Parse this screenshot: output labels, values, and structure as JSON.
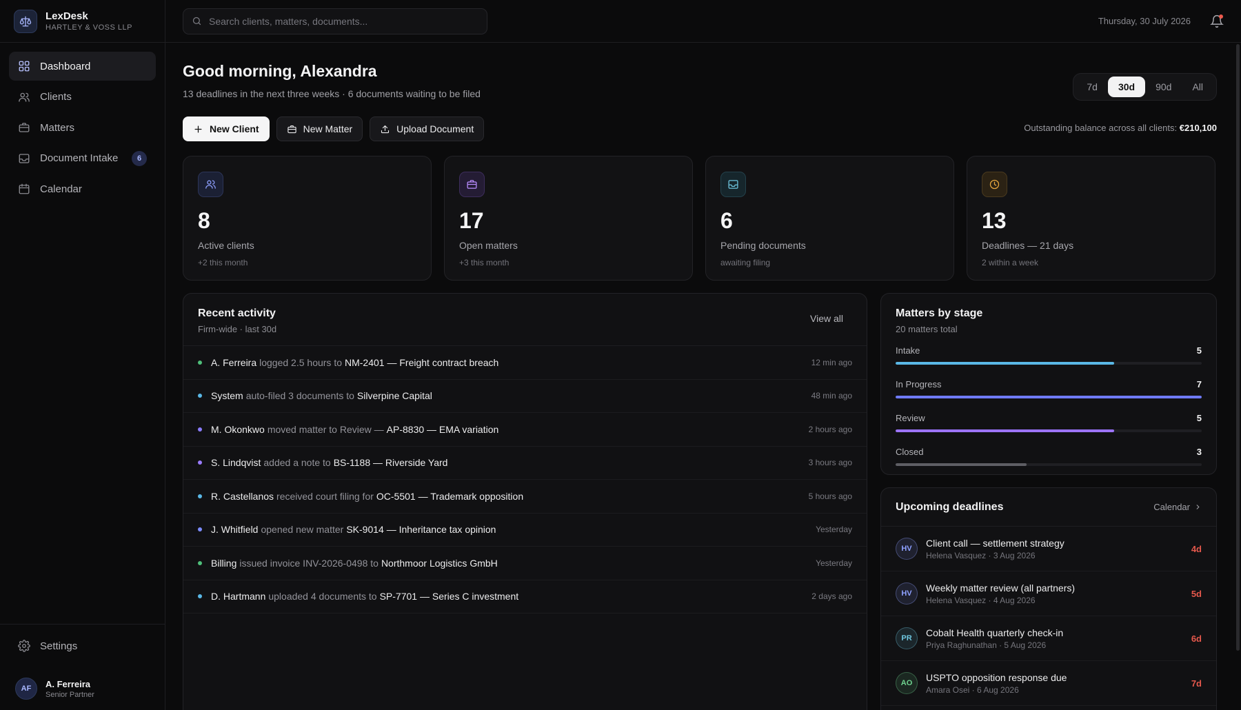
{
  "brand": {
    "name": "LexDesk",
    "firm": "HARTLEY & VOSS LLP",
    "logo_icon": "scales-icon"
  },
  "nav": {
    "items": [
      {
        "label": "Dashboard",
        "icon": "grid-icon",
        "active": true
      },
      {
        "label": "Clients",
        "icon": "users-icon"
      },
      {
        "label": "Matters",
        "icon": "briefcase-icon"
      },
      {
        "label": "Document Intake",
        "icon": "inbox-icon",
        "badge": "6"
      },
      {
        "label": "Calendar",
        "icon": "calendar-icon"
      }
    ],
    "settings_label": "Settings"
  },
  "user": {
    "initials": "AF",
    "name": "A. Ferreira",
    "role": "Senior Partner"
  },
  "topbar": {
    "search_placeholder": "Search clients, matters, documents...",
    "date": "Thursday, 30 July 2026"
  },
  "header": {
    "greeting": "Good morning, Alexandra",
    "subline": "13 deadlines in the next three weeks · 6 documents waiting to be filed",
    "ranges": [
      "7d",
      "30d",
      "90d",
      "All"
    ],
    "active_range": "30d",
    "balance_label": "Outstanding balance across all clients:",
    "balance_value": "€210,100"
  },
  "actions": {
    "new_client": "New Client",
    "new_matter": "New Matter",
    "upload": "Upload Document"
  },
  "stats": [
    {
      "value": "8",
      "label": "Active clients",
      "sub": "+2 this month",
      "icon": "users-icon",
      "color": "#8ea0ff"
    },
    {
      "value": "17",
      "label": "Open matters",
      "sub": "+3 this month",
      "icon": "briefcase-icon",
      "color": "#b98cff"
    },
    {
      "value": "6",
      "label": "Pending documents",
      "sub": "awaiting filing",
      "icon": "inbox-icon",
      "color": "#6fc7e0"
    },
    {
      "value": "13",
      "label": "Deadlines — 21 days",
      "sub": "2 within a week",
      "icon": "clock-icon",
      "color": "#e8a73e"
    }
  ],
  "activity": {
    "title": "Recent activity",
    "subtitle": "Firm-wide · last 30d",
    "view_all": "View all",
    "rows": [
      {
        "actor": "A. Ferreira",
        "verb": "logged 2.5 hours to",
        "target": "NM-2401 — Freight contract breach",
        "time": "12 min ago",
        "color": "#4fbf7a"
      },
      {
        "actor": "System",
        "verb": "auto-filed 3 documents to",
        "target": "Silverpine Capital",
        "time": "48 min ago",
        "color": "#5ab8e6"
      },
      {
        "actor": "M. Okonkwo",
        "verb": "moved matter to Review —",
        "target": "AP-8830 — EMA variation",
        "time": "2 hours ago",
        "color": "#8a7cff"
      },
      {
        "actor": "S. Lindqvist",
        "verb": "added a note to",
        "target": "BS-1188 — Riverside Yard",
        "time": "3 hours ago",
        "color": "#9a7cff"
      },
      {
        "actor": "R. Castellanos",
        "verb": "received court filing for",
        "target": "OC-5501 — Trademark opposition",
        "time": "5 hours ago",
        "color": "#5ab8e6"
      },
      {
        "actor": "J. Whitfield",
        "verb": "opened new matter",
        "target": "SK-9014 — Inheritance tax opinion",
        "time": "Yesterday",
        "color": "#7c8cff"
      },
      {
        "actor": "Billing",
        "verb": "issued invoice INV-2026-0498 to",
        "target": "Northmoor Logistics GmbH",
        "time": "Yesterday",
        "color": "#4fbf7a"
      },
      {
        "actor": "D. Hartmann",
        "verb": "uploaded 4 documents to",
        "target": "SP-7701 — Series C investment",
        "time": "2 days ago",
        "color": "#5ab8e6"
      }
    ]
  },
  "stages": {
    "title": "Matters by stage",
    "subtitle": "20 matters total",
    "max": 7,
    "rows": [
      {
        "label": "Intake",
        "count": "5",
        "value": 5,
        "color": "#5ab8e6"
      },
      {
        "label": "In Progress",
        "count": "7",
        "value": 7,
        "color": "#6f7bff"
      },
      {
        "label": "Review",
        "count": "5",
        "value": 5,
        "color": "#9c74ff"
      },
      {
        "label": "Closed",
        "count": "3",
        "value": 3,
        "color": "#5e5e64"
      }
    ]
  },
  "deadlines": {
    "title": "Upcoming deadlines",
    "link": "Calendar",
    "rows": [
      {
        "initials": "HV",
        "title": "Client call — settlement strategy",
        "meta": "Helena Vasquez · 3 Aug 2026",
        "days": "4d",
        "color": "#8ea0ff"
      },
      {
        "initials": "HV",
        "title": "Weekly matter review (all partners)",
        "meta": "Helena Vasquez · 4 Aug 2026",
        "days": "5d",
        "color": "#8ea0ff"
      },
      {
        "initials": "PR",
        "title": "Cobalt Health quarterly check-in",
        "meta": "Priya Raghunathan · 5 Aug 2026",
        "days": "6d",
        "color": "#6fc7e0"
      },
      {
        "initials": "AO",
        "title": "USPTO opposition response due",
        "meta": "Amara Osei · 6 Aug 2026",
        "days": "7d",
        "color": "#6fd38f"
      }
    ]
  }
}
